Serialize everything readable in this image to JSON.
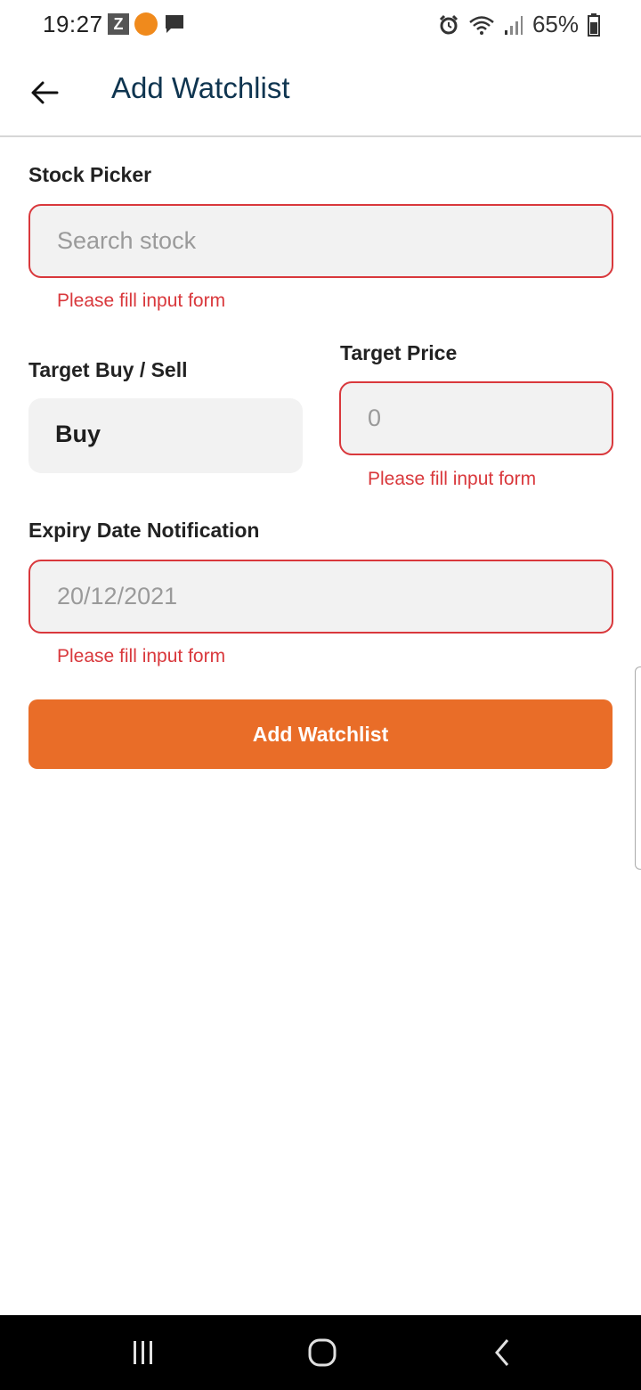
{
  "status_bar": {
    "time": "19:27",
    "battery": "65%",
    "left_icons": [
      "z-icon",
      "stage-club-icon",
      "chat-icon"
    ],
    "right_icons": [
      "alarm-icon",
      "wifi-icon",
      "signal-icon",
      "battery-icon"
    ],
    "z_label": "Z"
  },
  "app_bar": {
    "title": "Add Watchlist",
    "back_icon": "arrow-left-icon"
  },
  "form": {
    "stock_picker": {
      "label": "Stock Picker",
      "placeholder": "Search stock",
      "error": "Please fill input form"
    },
    "target_buy_sell": {
      "label": "Target Buy / Sell",
      "value": "Buy"
    },
    "target_price": {
      "label": "Target Price",
      "placeholder": "0",
      "error": "Please fill input form"
    },
    "expiry_date": {
      "label": "Expiry Date Notification",
      "placeholder": "20/12/2021",
      "error": "Please fill input form"
    },
    "submit_label": "Add Watchlist"
  },
  "colors": {
    "accent": "#e96d28",
    "error": "#d9383c",
    "title": "#0f3550",
    "field_bg": "#f2f2f2"
  },
  "nav_bar": {
    "icons": [
      "recent-apps-icon",
      "home-icon",
      "back-icon"
    ]
  }
}
